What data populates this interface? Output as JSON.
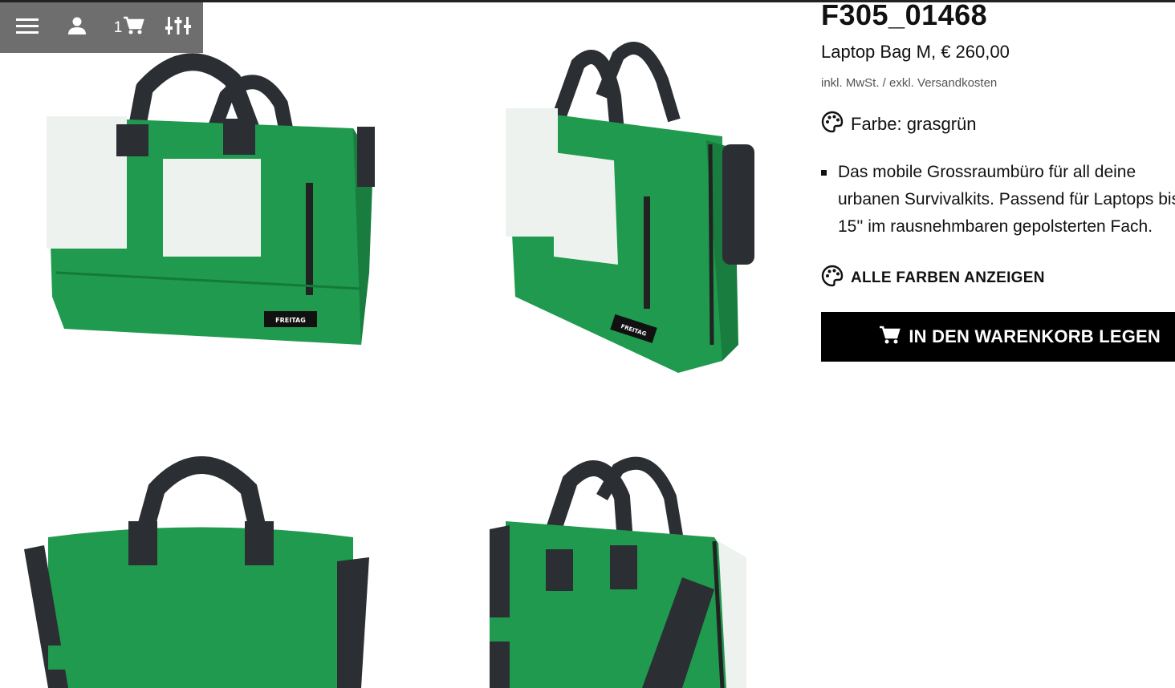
{
  "toolbar": {
    "menu_icon": "hamburger-menu-icon",
    "user_icon": "user-icon",
    "cart_count": "1",
    "cart_icon": "cart-icon",
    "filter_icon": "filter-sliders-icon",
    "background": "#6e6e6e"
  },
  "gallery": [
    {
      "name": "bag-front-view"
    },
    {
      "name": "bag-side-view"
    },
    {
      "name": "bag-back-view"
    },
    {
      "name": "bag-back-side-view"
    }
  ],
  "product": {
    "title": "F305_01468",
    "subtitle": "Laptop Bag M, € 260,00",
    "tax_note": "inkl. MwSt. / exkl. Versandkosten",
    "color_label": "Farbe: grasgrün",
    "description": "Das mobile Grossraumbüro für all deine urbanen Survivalkits. Passend für Laptops bis 15'' im rausnehmbaren gepolsterten Fach.",
    "all_colors_label": "ALLE FARBEN ANZEIGEN",
    "add_to_cart_label": "IN DEN WARENKORB LEGEN"
  },
  "colors": {
    "bag_green": "#1f9a4e",
    "bag_white": "#eef2ee",
    "strap": "#2b2f34",
    "button": "#000000"
  }
}
